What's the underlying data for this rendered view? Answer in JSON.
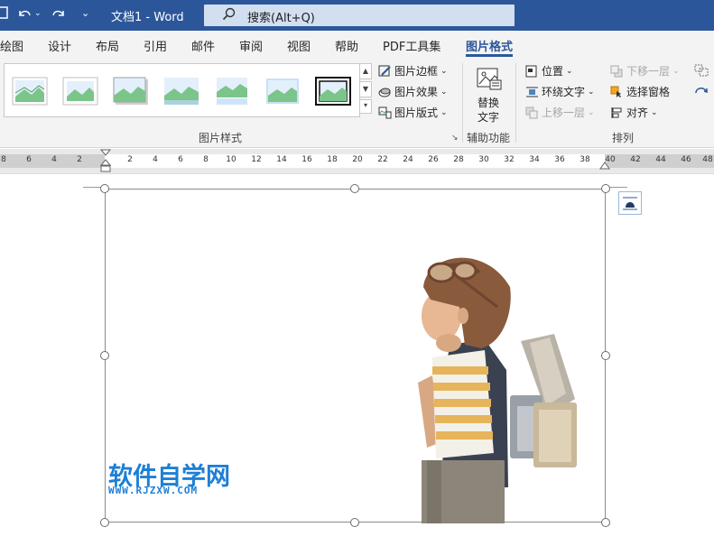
{
  "titlebar": {
    "doc_title": "文档1  -  Word",
    "search_placeholder": "搜索(Alt+Q)"
  },
  "tabs": [
    {
      "label": "绘图"
    },
    {
      "label": "设计"
    },
    {
      "label": "布局"
    },
    {
      "label": "引用"
    },
    {
      "label": "邮件"
    },
    {
      "label": "审阅"
    },
    {
      "label": "视图"
    },
    {
      "label": "帮助"
    },
    {
      "label": "PDF工具集"
    },
    {
      "label": "图片格式",
      "active": true
    }
  ],
  "ribbon": {
    "picture_styles": {
      "border_label": "图片边框",
      "effects_label": "图片效果",
      "layout_label": "图片版式",
      "group_label": "图片样式"
    },
    "accessibility": {
      "alt_text_line1": "替换",
      "alt_text_line2": "文字",
      "group_label": "辅助功能"
    },
    "arrange": {
      "position_label": "位置",
      "wrap_text_label": "环绕文字",
      "bring_forward_label": "上移一层",
      "send_backward_label": "下移一层",
      "selection_pane_label": "选择窗格",
      "align_label": "对齐",
      "group_label": "排列"
    }
  },
  "ruler": {
    "ticks": [
      "8",
      "6",
      "4",
      "2",
      "2",
      "4",
      "6",
      "8",
      "10",
      "12",
      "14",
      "16",
      "18",
      "20",
      "22",
      "24",
      "26",
      "28",
      "30",
      "32",
      "34",
      "36",
      "38",
      "40",
      "42",
      "44",
      "46",
      "48"
    ]
  },
  "picture": {
    "watermark_cn": "软件自学网",
    "watermark_en": "WWW.RJZXW.COM"
  },
  "colors": {
    "accent": "#2b579a",
    "ribbon_bg": "#f3f3f3",
    "watermark": "#1e7fd6"
  }
}
